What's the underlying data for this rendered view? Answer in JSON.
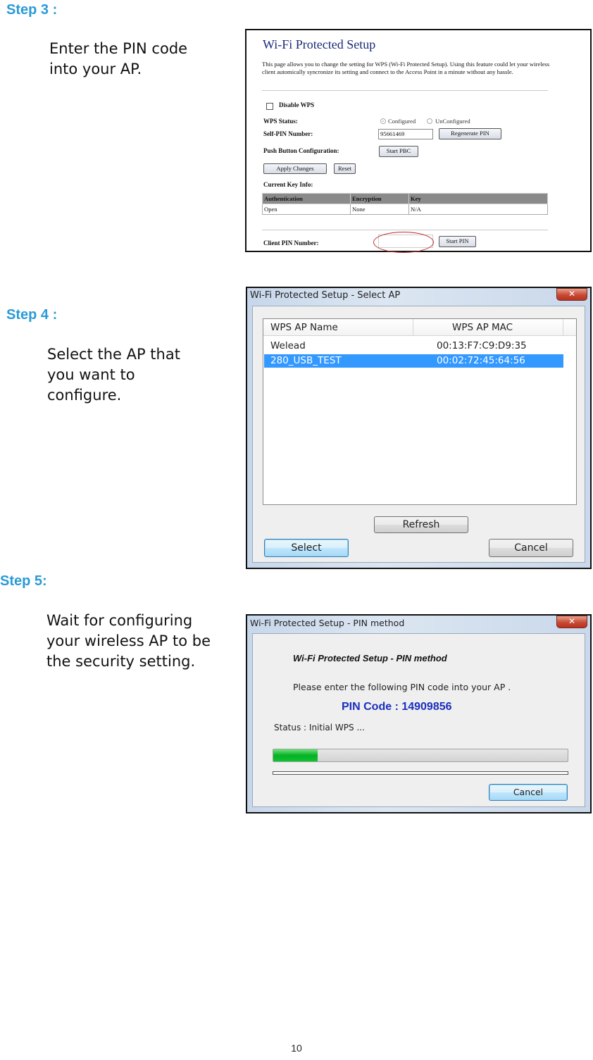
{
  "steps": [
    {
      "title": "Step 3 :",
      "description": "Enter the PIN code\ninto your AP."
    },
    {
      "title": "Step 4 :",
      "description": "Select the AP that\nyou want to\nconfigure."
    },
    {
      "title": "Step 5:",
      "description": "Wait for configuring\nyour wireless AP to be\nthe security setting."
    }
  ],
  "wps_web_page": {
    "title": "Wi-Fi Protected Setup",
    "intro": "This page allows you to change the setting for WPS (Wi-Fi Protected Setup). Using this feature could let your wireless client automically syncronize its setting and connect to the Access Point in a minute without any hassle.",
    "disable_wps_label": "Disable WPS",
    "disable_wps_checked": false,
    "wps_status_label": "WPS Status:",
    "wps_status_options": [
      "Configured",
      "UnConfigured"
    ],
    "wps_status_selected": "Configured",
    "self_pin_label": "Self-PIN Number:",
    "self_pin_value": "95661469",
    "regenerate_pin_label": "Regenerate PIN",
    "push_button_label": "Push Button Configuration:",
    "start_pbc_label": "Start PBC",
    "apply_changes_label": "Apply Changes",
    "reset_label": "Reset",
    "current_key_info_label": "Current Key Info:",
    "key_table": {
      "headers": [
        "Authentication",
        "Encryption",
        "Key"
      ],
      "rows": [
        [
          "Open",
          "None",
          "N/A"
        ]
      ]
    },
    "client_pin_label": "Client PIN Number:",
    "client_pin_value": "",
    "start_pin_label": "Start PIN",
    "highlight_color": "#c03030"
  },
  "select_ap_dialog": {
    "title": "Wi-Fi Protected Setup - Select AP",
    "close_glyph": "✕",
    "columns": [
      "WPS AP Name",
      "WPS AP MAC"
    ],
    "rows": [
      {
        "name": "Welead",
        "mac": "00:13:F7:C9:D9:35",
        "selected": false
      },
      {
        "name": "280_USB_TEST",
        "mac": "00:02:72:45:64:56",
        "selected": true
      }
    ],
    "refresh_label": "Refresh",
    "select_label": "Select",
    "cancel_label": "Cancel",
    "selection_color": "#3399ff"
  },
  "pin_method_dialog": {
    "title": "Wi-Fi Protected Setup - PIN method",
    "close_glyph": "✕",
    "heading": "Wi-Fi Protected Setup - PIN method",
    "instruction": "Please enter the following PIN code into your AP .",
    "pin_code_text": "PIN Code :  14909856",
    "status_text": "Status : Initial WPS ...",
    "progress_percent": 15,
    "cancel_label": "Cancel",
    "pin_color": "#1a2fbf"
  },
  "page_number": "10"
}
